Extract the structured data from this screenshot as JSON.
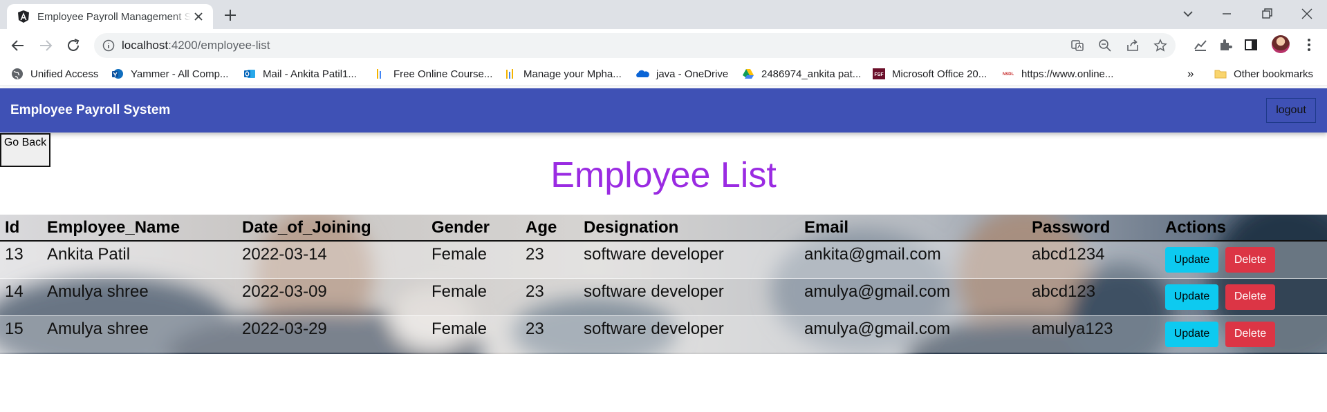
{
  "browser": {
    "tab_title": "Employee Payroll Management S",
    "url_host": "localhost",
    "url_path": ":4200/employee-list",
    "bookmarks": [
      {
        "label": "Unified Access",
        "icon": "globe-icon"
      },
      {
        "label": "Yammer - All Comp...",
        "icon": "yammer-icon"
      },
      {
        "label": "Mail - Ankita Patil1...",
        "icon": "outlook-icon"
      },
      {
        "label": "Free Online Course...",
        "icon": "course-icon"
      },
      {
        "label": "Manage your Mpha...",
        "icon": "mphasis-icon"
      },
      {
        "label": "java - OneDrive",
        "icon": "onedrive-icon"
      },
      {
        "label": "2486974_ankita pat...",
        "icon": "google-drive-icon"
      },
      {
        "label": "Microsoft Office 20...",
        "icon": "fsf-icon"
      },
      {
        "label": "https://www.online...",
        "icon": "nsdl-icon"
      }
    ],
    "overflow_label": "»",
    "other_bookmarks": "Other bookmarks"
  },
  "app": {
    "brand": "Employee Payroll System",
    "logout_label": "logout",
    "go_back_label": "Go Back",
    "page_title": "Employee List",
    "colors": {
      "navbar": "#3f51b5",
      "title": "#9a2be2",
      "update_button": "#0dcaf0",
      "delete_button": "#dc3545"
    }
  },
  "table": {
    "columns": [
      "Id",
      "Employee_Name",
      "Date_of_Joining",
      "Gender",
      "Age",
      "Designation",
      "Email",
      "Password",
      "Actions"
    ],
    "rows": [
      {
        "id": "13",
        "name": "Ankita Patil",
        "date": "2022-03-14",
        "gender": "Female",
        "age": "23",
        "designation": "software developer",
        "email": "ankita@gmail.com",
        "password": "abcd1234"
      },
      {
        "id": "14",
        "name": "Amulya shree",
        "date": "2022-03-09",
        "gender": "Female",
        "age": "23",
        "designation": "software developer",
        "email": "amulya@gmail.com",
        "password": "abcd123"
      },
      {
        "id": "15",
        "name": "Amulya shree",
        "date": "2022-03-29",
        "gender": "Female",
        "age": "23",
        "designation": "software developer",
        "email": "amulya@gmail.com",
        "password": "amulya123"
      }
    ],
    "update_label": "Update",
    "delete_label": "Delete"
  }
}
